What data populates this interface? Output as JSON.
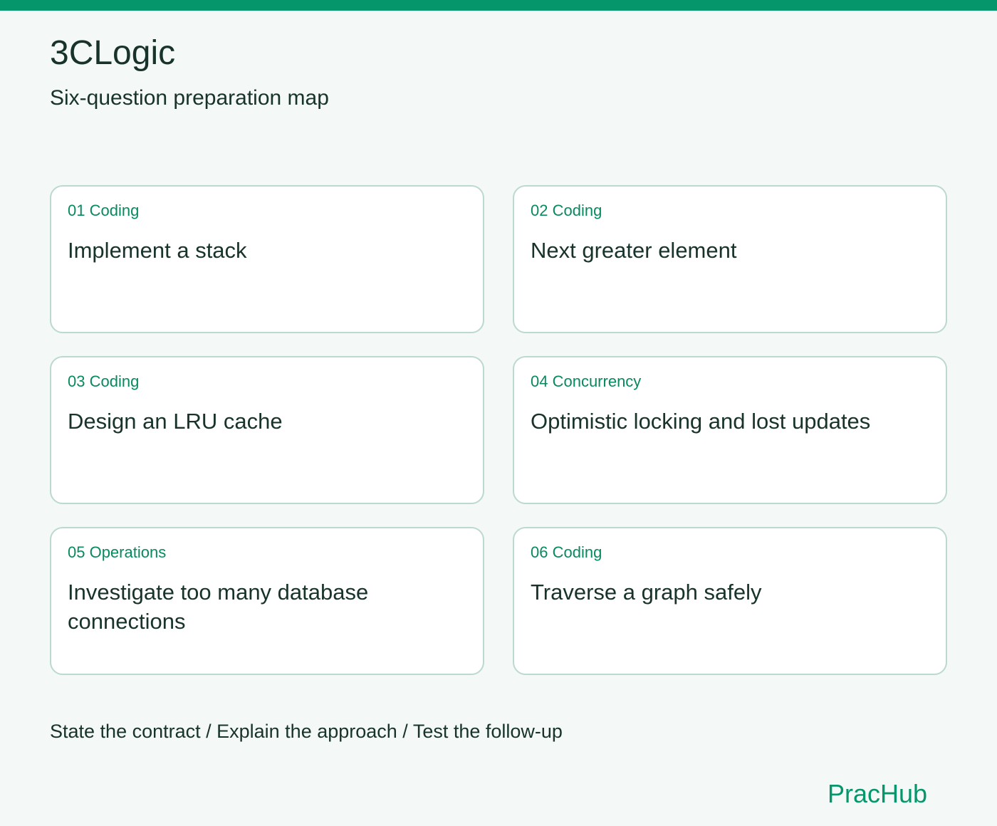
{
  "header": {
    "title": "3CLogic",
    "subtitle": "Six-question preparation map"
  },
  "cards": [
    {
      "tag": "01 Coding",
      "title": "Implement a stack"
    },
    {
      "tag": "02 Coding",
      "title": "Next greater element"
    },
    {
      "tag": "03 Coding",
      "title": "Design an LRU cache"
    },
    {
      "tag": "04 Concurrency",
      "title": "Optimistic locking and lost updates"
    },
    {
      "tag": "05 Operations",
      "title": "Investigate too many database connections"
    },
    {
      "tag": "06 Coding",
      "title": "Traverse a graph safely"
    }
  ],
  "footer": {
    "steps": "State the contract / Explain the approach / Test the follow-up",
    "brand": "PracHub"
  },
  "colors": {
    "accent": "#05976b",
    "card_border": "#bcd9cf",
    "background": "#f4f8f6",
    "text": "#17332c"
  }
}
